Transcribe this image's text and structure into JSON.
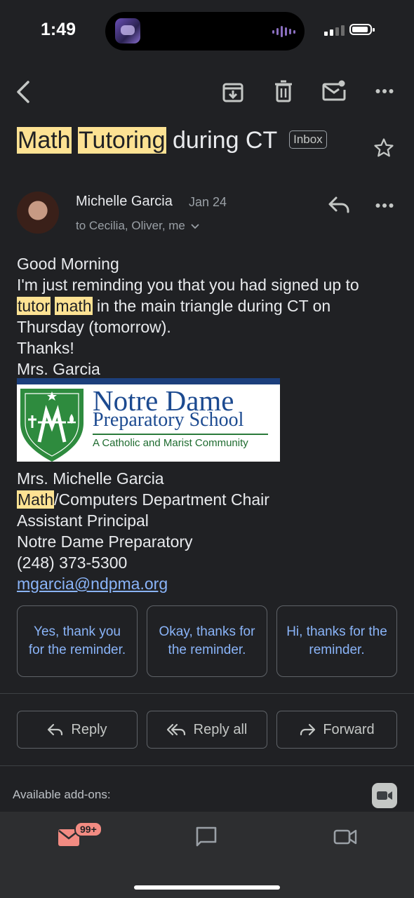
{
  "status_bar": {
    "time": "1:49"
  },
  "email": {
    "subject_part1": "Math",
    "subject_part2": "Tutoring",
    "subject_rest": " during CT",
    "label": "Inbox",
    "sender_name": "Michelle Garcia",
    "date": "Jan 24",
    "recipients": "to Cecilia, Oliver, me",
    "body": {
      "greeting": "Good Morning",
      "line1": "I'm just reminding you that you had signed up to",
      "line2_hl1": "tutor",
      "line2_hl2": "math",
      "line2_rest": " in the main triangle during CT on",
      "line3": "Thursday (tomorrow).",
      "line4": "Thanks!",
      "line5": "Mrs. Garcia"
    },
    "logo": {
      "line1": "Notre Dame",
      "line2": "Preparatory School",
      "line3": "A Catholic and Marist Community"
    },
    "signature": {
      "name": "Mrs. Michelle Garcia",
      "title_hl": "Math",
      "title_rest": "/Computers Department Chair",
      "role": "Assistant Principal",
      "org": "Notre Dame Preparatory",
      "phone": "(248) 373-5300",
      "email": "mgarcia@ndpma.org"
    }
  },
  "smart_replies": [
    "Yes, thank you for the reminder.",
    "Okay, thanks for the reminder.",
    "Hi, thanks for the reminder."
  ],
  "actions": {
    "reply": "Reply",
    "reply_all": "Reply all",
    "forward": "Forward"
  },
  "addons_label": "Available add-ons:",
  "bottom_nav": {
    "mail_badge": "99+"
  },
  "colors": {
    "background": "#202124",
    "highlight": "#fde293",
    "link": "#8ab4f8",
    "badge": "#f28b82"
  }
}
